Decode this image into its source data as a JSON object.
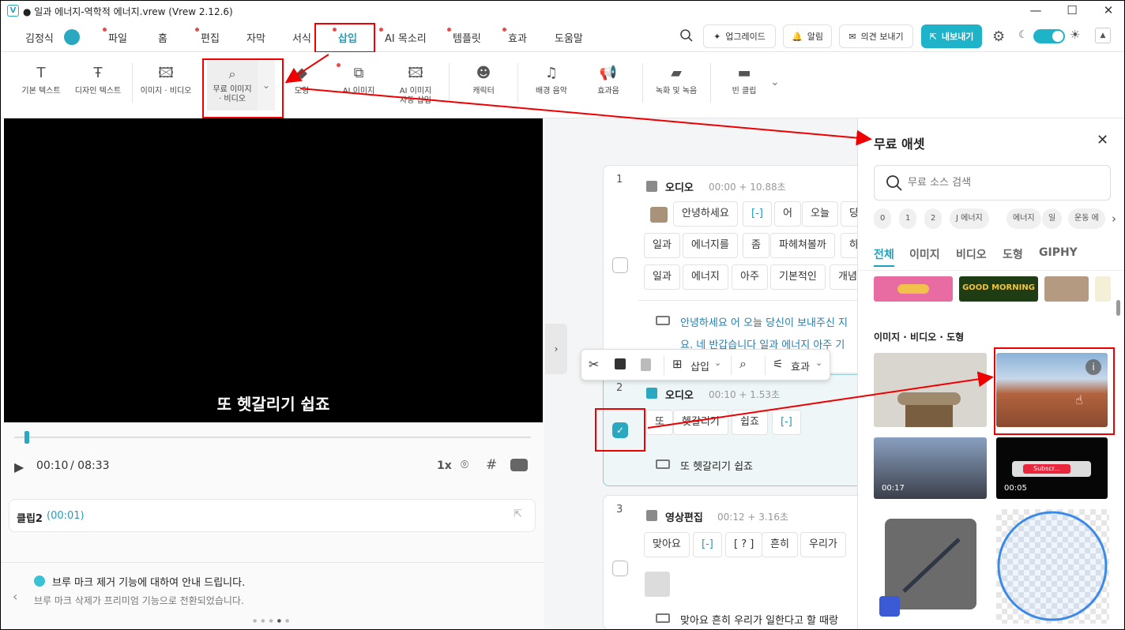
{
  "window": {
    "title": "● 일과 에너지-역학적 에너지.vrew (Vrew 2.12.6)",
    "logo": "V"
  },
  "menubar": {
    "user": "김정식",
    "items": [
      "파일",
      "홈",
      "편집",
      "자막",
      "서식",
      "삽입",
      "AI 목소리",
      "템플릿",
      "효과",
      "도움말"
    ],
    "upgrade": "업그레이드",
    "alarm": "알림",
    "feedback": "의견 보내기",
    "export": "내보내기"
  },
  "toolbar": {
    "basic_text": "기본 텍스트",
    "design_text": "디자인 텍스트",
    "image_video": "이미지 · 비디오",
    "free_line1": "무료 이미지",
    "free_line2": "· 비디오",
    "shape": "도형",
    "ai_image": "AI 이미지",
    "ai_auto1": "AI 이미지",
    "ai_auto2": "자동 삽입",
    "character": "캐릭터",
    "bgm": "배경 음악",
    "sfx": "효과음",
    "record": "녹화 및 녹음",
    "empty_clip": "빈 클립"
  },
  "player": {
    "caption": "또 헷갈리기 쉽죠",
    "current": "00:10",
    "total": "/ 08:33",
    "speed": "1x",
    "clip_label": "클립2",
    "clip_time": "(00:01)",
    "notice_title": "브루 마크 제거 기능에 대하여 안내 드립니다.",
    "notice_body": "브루 마크 삭제가 프리미엄 기능으로 전환되었습니다."
  },
  "clips": [
    {
      "num": "1",
      "type": "오디오",
      "time": "00:00 + 10.88초",
      "row1": [
        "안녕하세요",
        "[-]",
        "어",
        "오늘",
        "당"
      ],
      "row2": [
        "일과",
        "에너지를",
        "좀",
        "파헤쳐볼까",
        "하"
      ],
      "row3": [
        "일과",
        "에너지",
        "아주",
        "기본적인",
        "개념"
      ],
      "sub1": "안녕하세요 어 오늘 당신이 보내주신 지",
      "sub2": "요. 네 반갑습니다 일과 에너지 아주 기"
    },
    {
      "num": "2",
      "type": "오디오",
      "time": "00:10 + 1.53초",
      "row1": [
        "또",
        "헷갈리기",
        "쉽죠",
        "[-]"
      ],
      "sub1": "또 헷갈리기 쉽죠"
    },
    {
      "num": "3",
      "type": "영상편집",
      "time": "00:12 + 3.16초",
      "row1": [
        "맞아요",
        "[-]",
        "[ ? ]",
        "흔히",
        "우리가"
      ],
      "sub1": "맞아요 흔히 우리가 일한다고 할 때랑"
    }
  ],
  "popup": {
    "insert": "삽입",
    "effect": "효과"
  },
  "assets": {
    "title": "무료 애셋",
    "search_placeholder": "무료 소스 검색",
    "tags": [
      "0",
      "1",
      "2",
      "J 에너지",
      "에너지",
      "일",
      "운동 에"
    ],
    "filters": [
      "전체",
      "이미지",
      "비디오",
      "도형",
      "GIPHY"
    ],
    "section": "이미지 · 비디오 · 도형",
    "strip_text": "GOOD MORNING",
    "video1_time": "00:17",
    "video2_time": "00:05",
    "video2_text": "Subscr..."
  }
}
